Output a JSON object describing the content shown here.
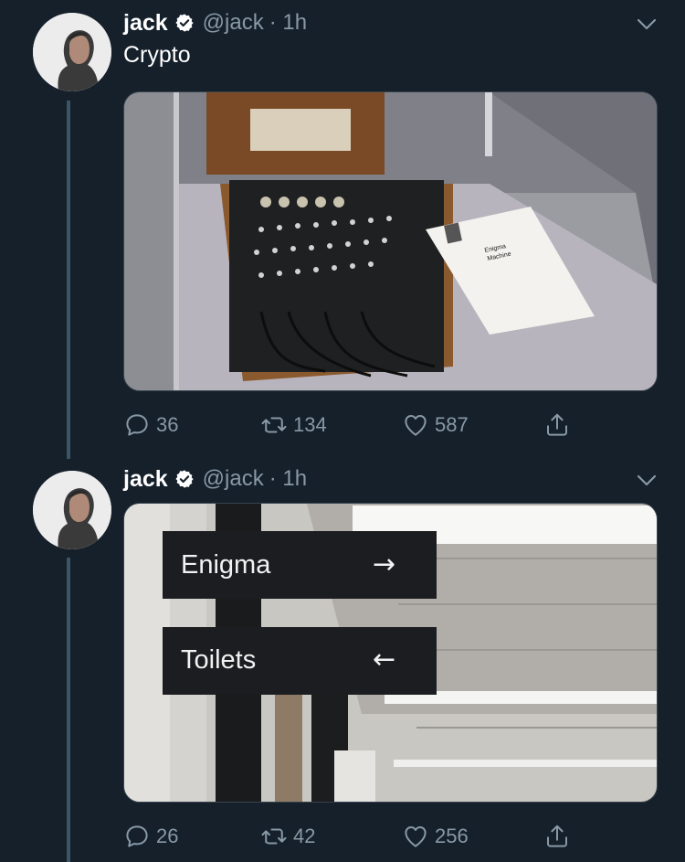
{
  "tweets": [
    {
      "author_name": "jack",
      "handle": "@jack",
      "time": "· 1h",
      "text": "Crypto",
      "replies": "36",
      "retweets": "134",
      "likes": "587",
      "photo": "enigma-machine-exhibit",
      "photo_caption": "Enigma\nMachine"
    },
    {
      "author_name": "jack",
      "handle": "@jack",
      "time": "· 1h",
      "replies": "26",
      "retweets": "42",
      "likes": "256",
      "photo": "wayfinding-sign",
      "signs": [
        {
          "label": "Enigma",
          "arrow": "→"
        },
        {
          "label": "Toilets",
          "arrow": "←"
        }
      ]
    }
  ],
  "colors": {
    "background": "#15202b",
    "muted": "#8899a6",
    "thread_line": "#3d5466",
    "verified": "#ffffff"
  }
}
